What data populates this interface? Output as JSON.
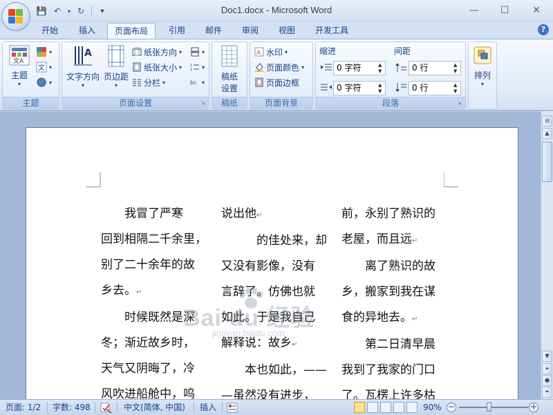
{
  "window": {
    "title": "Doc1.docx - Microsoft Word",
    "minimize": "—",
    "maximize": "☐",
    "close": "✕"
  },
  "qat": {
    "save": "💾",
    "undo": "↶",
    "redo": "↻",
    "customize": "▾"
  },
  "tabs": [
    "开始",
    "插入",
    "页面布局",
    "引用",
    "邮件",
    "审阅",
    "视图",
    "开发工具"
  ],
  "active_tab": "页面布局",
  "help": "?",
  "ribbon": {
    "themes_group": {
      "label": "主题",
      "themes_button": "主题"
    },
    "page_setup_group": {
      "label": "页面设置",
      "text_direction": "文字方向",
      "margins": "页边距",
      "orientation": "纸张方向",
      "size": "纸张大小",
      "columns": "分栏"
    },
    "draft_group": {
      "label": "稿纸",
      "draft_setup_line1": "稿纸",
      "draft_setup_line2": "设置"
    },
    "background_group": {
      "label": "页面背景",
      "watermark": "水印",
      "page_color": "页面颜色",
      "page_borders": "页面边框"
    },
    "paragraph_group": {
      "label": "段落",
      "indent_label": "缩进",
      "spacing_label": "间距",
      "indent_left": "0 字符",
      "indent_right": "0 字符",
      "spacing_before": "0 行",
      "spacing_after": "0 行"
    },
    "arrange_group": {
      "arrange": "排列"
    }
  },
  "document": {
    "columns": [
      [
        "　　我冒了严寒",
        "回到相隔二千余里，",
        "别了二十余年的故",
        "乡去。",
        "　　时候既然是深",
        "冬；渐近故乡时，",
        "天气又阴晦了，冷",
        "风吹进船舱中，呜"
      ],
      [
        "说出他",
        "　　　的佳处来，却",
        "又没有影像，没有",
        "言辞了。仿佛也就",
        "如此。于是我自己",
        "解释说：故乡",
        "　　本也如此，——",
        "—虽然没有进步，"
      ],
      [
        "前，永别了熟识的",
        "老屋，而且远",
        "　　离了熟识的故",
        "乡，搬家到我在谋",
        "食的异地去。",
        "　　第二日清早晨",
        "我到了我家的门口",
        "了。瓦楞上许多枯"
      ]
    ],
    "paragraph_mark": "↵",
    "paragraph_lines": [
      [
        3
      ],
      [
        0,
        5
      ],
      [
        1,
        4
      ]
    ],
    "watermark_text": "Bai du 经验",
    "watermark_sub": "jingyan.baidu.com"
  },
  "status": {
    "page": "页面: 1/2",
    "words": "字数: 498",
    "language": "中文(简体, 中国)",
    "mode": "插入",
    "zoom": "90%",
    "zoom_level": 0.5
  }
}
